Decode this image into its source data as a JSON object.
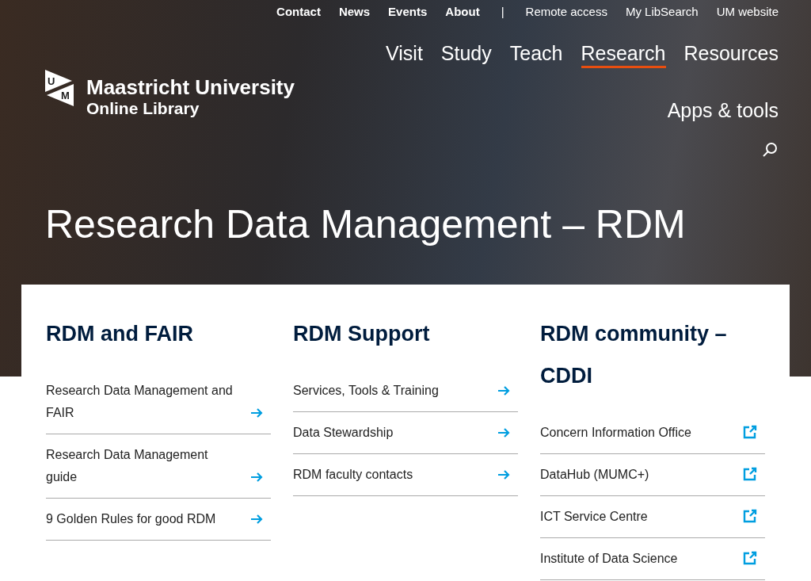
{
  "utility_nav": {
    "primary": [
      "Contact",
      "News",
      "Events",
      "About"
    ],
    "separator": "|",
    "secondary": [
      "Remote access",
      "My LibSearch",
      "UM website"
    ]
  },
  "logo": {
    "mark_letters": [
      "U",
      "M"
    ],
    "name": "Maastricht University",
    "subtitle": "Online Library"
  },
  "main_nav": [
    {
      "label": "Visit",
      "selected": false
    },
    {
      "label": "Study",
      "selected": false
    },
    {
      "label": "Teach",
      "selected": false
    },
    {
      "label": "Research",
      "selected": true
    },
    {
      "label": "Resources",
      "selected": false
    }
  ],
  "secondary_nav": {
    "label": "Apps & tools"
  },
  "hero": {
    "title": "Research Data Management – RDM"
  },
  "columns": [
    {
      "heading": "RDM and FAIR",
      "links": [
        {
          "label": "Research Data Management and FAIR",
          "kind": "internal"
        },
        {
          "label": "Research Data Management guide",
          "kind": "internal"
        },
        {
          "label": "9 Golden Rules for good RDM",
          "kind": "internal"
        }
      ]
    },
    {
      "heading": "RDM Support",
      "links": [
        {
          "label": "Services, Tools & Training",
          "kind": "internal"
        },
        {
          "label": "Data Stewardship",
          "kind": "internal"
        },
        {
          "label": "RDM faculty contacts",
          "kind": "internal"
        }
      ]
    },
    {
      "heading": "RDM community – CDDI",
      "links": [
        {
          "label": "Concern Information Office",
          "kind": "external"
        },
        {
          "label": "DataHub (MUMC+)",
          "kind": "external"
        },
        {
          "label": "ICT Service Centre",
          "kind": "external"
        },
        {
          "label": "Institute of Data Science",
          "kind": "external"
        }
      ]
    }
  ]
}
